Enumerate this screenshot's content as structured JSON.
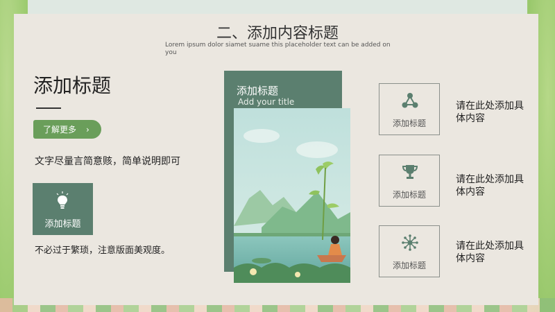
{
  "header": {
    "title": "二、添加内容标题",
    "subtitle": "Lorem ipsum dolor siamet suame this placeholder text can be added on you"
  },
  "left": {
    "title": "添加标题",
    "more_button": "了解更多",
    "more_arrow": "›",
    "description": "文字尽量言简意赅，简单说明即可",
    "icon_box_label": "添加标题",
    "note": "不必过于繁琐，注意版面美观度。"
  },
  "center": {
    "panel_title": "添加标题",
    "panel_subtitle": "Add your title"
  },
  "features": [
    {
      "label": "添加标题",
      "text": "请在此处添加具体内容",
      "icon": "share-nodes-icon"
    },
    {
      "label": "添加标题",
      "text": "请在此处添加具体内容",
      "icon": "trophy-icon"
    },
    {
      "label": "添加标题",
      "text": "请在此处添加具体内容",
      "icon": "network-icon"
    }
  ],
  "colors": {
    "accent_green": "#5b7f6f",
    "button_green": "#6a9e5a",
    "card_bg": "#ebe7e0"
  }
}
